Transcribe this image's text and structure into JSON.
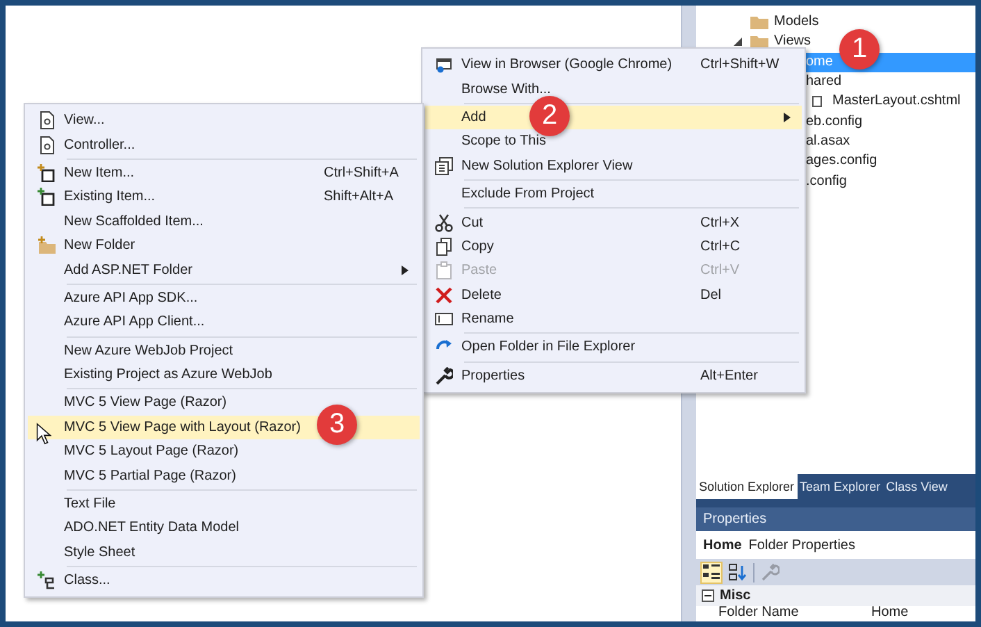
{
  "solution_explorer": {
    "tree": [
      {
        "text": "Models",
        "expanded": false,
        "selected": false
      },
      {
        "text": "Views",
        "expanded": true,
        "selected": false,
        "children": [
          {
            "text": "ome",
            "selected": true
          },
          {
            "text": "hared",
            "selected": false,
            "children": [
              {
                "text": "MasterLayout.cshtml",
                "selected": false
              }
            ]
          },
          {
            "text": "eb.config",
            "selected": false
          },
          {
            "text": "al.asax",
            "selected": false
          },
          {
            "text": "ages.config",
            "selected": false
          },
          {
            "text": ".config",
            "selected": false
          }
        ]
      }
    ]
  },
  "tool_tabs": [
    {
      "label": "Solution Explorer",
      "selected": true
    },
    {
      "label": "Team Explorer",
      "selected": false
    },
    {
      "label": "Class View",
      "selected": false
    }
  ],
  "properties": {
    "title": "Properties",
    "object_name": "Home",
    "object_type": "Folder Properties",
    "toolbar": [
      {
        "selected": true,
        "disabled": false
      },
      {
        "selected": false,
        "disabled": false
      },
      {
        "selected": false,
        "disabled": true
      }
    ],
    "category": {
      "label": "Misc",
      "expanded": true
    },
    "rows": [
      {
        "name": "Folder Name",
        "value": "Home"
      }
    ]
  },
  "context_menu": {
    "items": [
      {
        "kind": "item",
        "label": "View in Browser (Google Chrome)",
        "shortcut": "Ctrl+Shift+W",
        "selected": false,
        "disabled": false,
        "submenu": false
      },
      {
        "kind": "item",
        "label": "Browse With...",
        "selected": false,
        "disabled": false,
        "submenu": false
      },
      {
        "kind": "separator"
      },
      {
        "kind": "item",
        "label": "Add",
        "selected": true,
        "disabled": false,
        "submenu": true
      },
      {
        "kind": "item",
        "label": "Scope to This",
        "selected": false,
        "disabled": false,
        "submenu": false
      },
      {
        "kind": "item",
        "label": "New Solution Explorer View",
        "selected": false,
        "disabled": false,
        "submenu": false
      },
      {
        "kind": "separator"
      },
      {
        "kind": "item",
        "label": "Exclude From Project",
        "selected": false,
        "disabled": false,
        "submenu": false
      },
      {
        "kind": "separator"
      },
      {
        "kind": "item",
        "label": "Cut",
        "shortcut": "Ctrl+X",
        "selected": false,
        "disabled": false,
        "submenu": false
      },
      {
        "kind": "item",
        "label": "Copy",
        "shortcut": "Ctrl+C",
        "selected": false,
        "disabled": false,
        "submenu": false
      },
      {
        "kind": "item",
        "label": "Paste",
        "shortcut": "Ctrl+V",
        "selected": false,
        "disabled": true,
        "submenu": false
      },
      {
        "kind": "item",
        "label": "Delete",
        "shortcut": "Del",
        "selected": false,
        "disabled": false,
        "submenu": false
      },
      {
        "kind": "item",
        "label": "Rename",
        "selected": false,
        "disabled": false,
        "submenu": false
      },
      {
        "kind": "separator"
      },
      {
        "kind": "item",
        "label": "Open Folder in File Explorer",
        "selected": false,
        "disabled": false,
        "submenu": false
      },
      {
        "kind": "separator"
      },
      {
        "kind": "item",
        "label": "Properties",
        "shortcut": "Alt+Enter",
        "selected": false,
        "disabled": false,
        "submenu": false
      }
    ]
  },
  "add_submenu": {
    "items": [
      {
        "kind": "item",
        "label": "View...",
        "selected": false,
        "submenu": false
      },
      {
        "kind": "item",
        "label": "Controller...",
        "selected": false,
        "submenu": false
      },
      {
        "kind": "separator"
      },
      {
        "kind": "item",
        "label": "New Item...",
        "shortcut": "Ctrl+Shift+A",
        "selected": false,
        "submenu": false
      },
      {
        "kind": "item",
        "label": "Existing Item...",
        "shortcut": "Shift+Alt+A",
        "selected": false,
        "submenu": false
      },
      {
        "kind": "item",
        "label": "New Scaffolded Item...",
        "selected": false,
        "submenu": false
      },
      {
        "kind": "item",
        "label": "New Folder",
        "selected": false,
        "submenu": false
      },
      {
        "kind": "item",
        "label": "Add ASP.NET Folder",
        "selected": false,
        "submenu": true
      },
      {
        "kind": "separator"
      },
      {
        "kind": "item",
        "label": "Azure API App SDK...",
        "selected": false,
        "submenu": false
      },
      {
        "kind": "item",
        "label": "Azure API App Client...",
        "selected": false,
        "submenu": false
      },
      {
        "kind": "separator"
      },
      {
        "kind": "item",
        "label": "New Azure WebJob Project",
        "selected": false,
        "submenu": false
      },
      {
        "kind": "item",
        "label": "Existing Project as Azure WebJob",
        "selected": false,
        "submenu": false
      },
      {
        "kind": "separator"
      },
      {
        "kind": "item",
        "label": "MVC 5 View Page (Razor)",
        "selected": false,
        "submenu": false
      },
      {
        "kind": "item",
        "label": "MVC 5 View Page with Layout (Razor)",
        "selected": true,
        "submenu": false
      },
      {
        "kind": "item",
        "label": "MVC 5 Layout Page (Razor)",
        "selected": false,
        "submenu": false
      },
      {
        "kind": "item",
        "label": "MVC 5 Partial Page (Razor)",
        "selected": false,
        "submenu": false
      },
      {
        "kind": "separator"
      },
      {
        "kind": "item",
        "label": "Text File",
        "selected": false,
        "submenu": false
      },
      {
        "kind": "item",
        "label": "ADO.NET Entity Data Model",
        "selected": false,
        "submenu": false
      },
      {
        "kind": "item",
        "label": "Style Sheet",
        "selected": false,
        "submenu": false
      },
      {
        "kind": "separator"
      },
      {
        "kind": "item",
        "label": "Class...",
        "selected": false,
        "submenu": false
      }
    ]
  },
  "callouts": [
    "1",
    "2",
    "3"
  ]
}
